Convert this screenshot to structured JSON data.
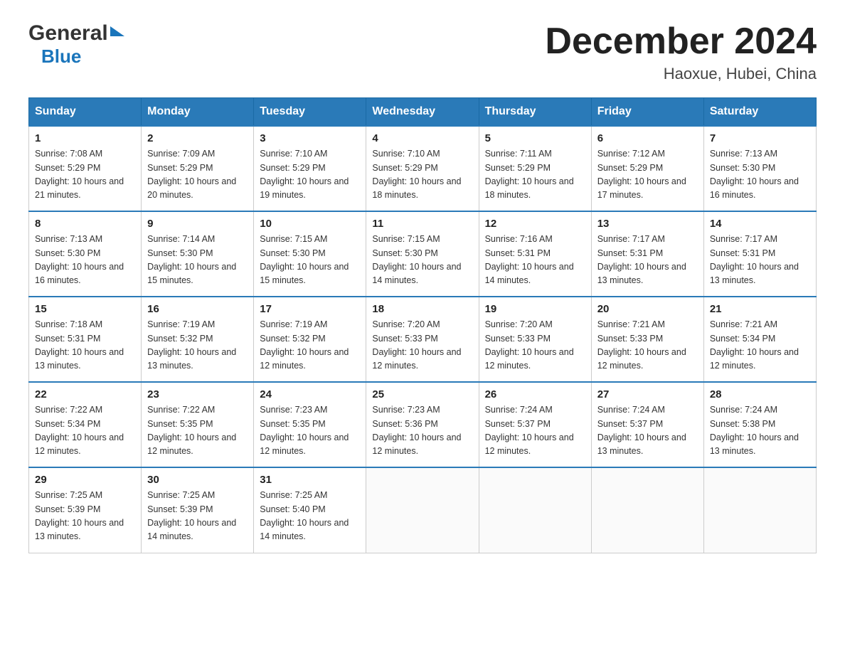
{
  "logo": {
    "general_text": "General",
    "blue_text": "Blue"
  },
  "header": {
    "month_year": "December 2024",
    "location": "Haoxue, Hubei, China"
  },
  "days_of_week": [
    "Sunday",
    "Monday",
    "Tuesday",
    "Wednesday",
    "Thursday",
    "Friday",
    "Saturday"
  ],
  "weeks": [
    [
      {
        "day": "1",
        "sunrise": "7:08 AM",
        "sunset": "5:29 PM",
        "daylight": "10 hours and 21 minutes."
      },
      {
        "day": "2",
        "sunrise": "7:09 AM",
        "sunset": "5:29 PM",
        "daylight": "10 hours and 20 minutes."
      },
      {
        "day": "3",
        "sunrise": "7:10 AM",
        "sunset": "5:29 PM",
        "daylight": "10 hours and 19 minutes."
      },
      {
        "day": "4",
        "sunrise": "7:10 AM",
        "sunset": "5:29 PM",
        "daylight": "10 hours and 18 minutes."
      },
      {
        "day": "5",
        "sunrise": "7:11 AM",
        "sunset": "5:29 PM",
        "daylight": "10 hours and 18 minutes."
      },
      {
        "day": "6",
        "sunrise": "7:12 AM",
        "sunset": "5:29 PM",
        "daylight": "10 hours and 17 minutes."
      },
      {
        "day": "7",
        "sunrise": "7:13 AM",
        "sunset": "5:30 PM",
        "daylight": "10 hours and 16 minutes."
      }
    ],
    [
      {
        "day": "8",
        "sunrise": "7:13 AM",
        "sunset": "5:30 PM",
        "daylight": "10 hours and 16 minutes."
      },
      {
        "day": "9",
        "sunrise": "7:14 AM",
        "sunset": "5:30 PM",
        "daylight": "10 hours and 15 minutes."
      },
      {
        "day": "10",
        "sunrise": "7:15 AM",
        "sunset": "5:30 PM",
        "daylight": "10 hours and 15 minutes."
      },
      {
        "day": "11",
        "sunrise": "7:15 AM",
        "sunset": "5:30 PM",
        "daylight": "10 hours and 14 minutes."
      },
      {
        "day": "12",
        "sunrise": "7:16 AM",
        "sunset": "5:31 PM",
        "daylight": "10 hours and 14 minutes."
      },
      {
        "day": "13",
        "sunrise": "7:17 AM",
        "sunset": "5:31 PM",
        "daylight": "10 hours and 13 minutes."
      },
      {
        "day": "14",
        "sunrise": "7:17 AM",
        "sunset": "5:31 PM",
        "daylight": "10 hours and 13 minutes."
      }
    ],
    [
      {
        "day": "15",
        "sunrise": "7:18 AM",
        "sunset": "5:31 PM",
        "daylight": "10 hours and 13 minutes."
      },
      {
        "day": "16",
        "sunrise": "7:19 AM",
        "sunset": "5:32 PM",
        "daylight": "10 hours and 13 minutes."
      },
      {
        "day": "17",
        "sunrise": "7:19 AM",
        "sunset": "5:32 PM",
        "daylight": "10 hours and 12 minutes."
      },
      {
        "day": "18",
        "sunrise": "7:20 AM",
        "sunset": "5:33 PM",
        "daylight": "10 hours and 12 minutes."
      },
      {
        "day": "19",
        "sunrise": "7:20 AM",
        "sunset": "5:33 PM",
        "daylight": "10 hours and 12 minutes."
      },
      {
        "day": "20",
        "sunrise": "7:21 AM",
        "sunset": "5:33 PM",
        "daylight": "10 hours and 12 minutes."
      },
      {
        "day": "21",
        "sunrise": "7:21 AM",
        "sunset": "5:34 PM",
        "daylight": "10 hours and 12 minutes."
      }
    ],
    [
      {
        "day": "22",
        "sunrise": "7:22 AM",
        "sunset": "5:34 PM",
        "daylight": "10 hours and 12 minutes."
      },
      {
        "day": "23",
        "sunrise": "7:22 AM",
        "sunset": "5:35 PM",
        "daylight": "10 hours and 12 minutes."
      },
      {
        "day": "24",
        "sunrise": "7:23 AM",
        "sunset": "5:35 PM",
        "daylight": "10 hours and 12 minutes."
      },
      {
        "day": "25",
        "sunrise": "7:23 AM",
        "sunset": "5:36 PM",
        "daylight": "10 hours and 12 minutes."
      },
      {
        "day": "26",
        "sunrise": "7:24 AM",
        "sunset": "5:37 PM",
        "daylight": "10 hours and 12 minutes."
      },
      {
        "day": "27",
        "sunrise": "7:24 AM",
        "sunset": "5:37 PM",
        "daylight": "10 hours and 13 minutes."
      },
      {
        "day": "28",
        "sunrise": "7:24 AM",
        "sunset": "5:38 PM",
        "daylight": "10 hours and 13 minutes."
      }
    ],
    [
      {
        "day": "29",
        "sunrise": "7:25 AM",
        "sunset": "5:39 PM",
        "daylight": "10 hours and 13 minutes."
      },
      {
        "day": "30",
        "sunrise": "7:25 AM",
        "sunset": "5:39 PM",
        "daylight": "10 hours and 14 minutes."
      },
      {
        "day": "31",
        "sunrise": "7:25 AM",
        "sunset": "5:40 PM",
        "daylight": "10 hours and 14 minutes."
      },
      null,
      null,
      null,
      null
    ]
  ]
}
